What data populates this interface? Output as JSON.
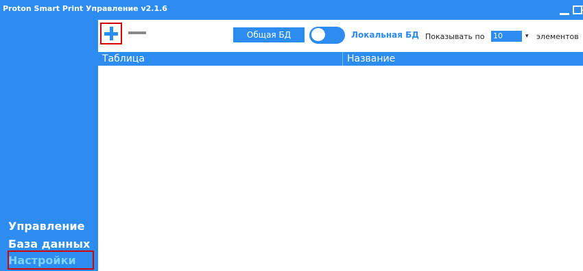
{
  "window": {
    "title": "Proton Smart Print Управление v2.1.6",
    "controls": {
      "minimize": "minimize-icon",
      "maximize": "maximize-icon",
      "close": "✕"
    }
  },
  "sidebar": {
    "items": [
      {
        "label": "Управление",
        "active": false
      },
      {
        "label": "База данных",
        "active": false
      },
      {
        "label": "Настройки",
        "active": true
      }
    ]
  },
  "toolbar": {
    "add_icon": "plus-icon",
    "remove_icon": "minus-icon",
    "shared_db_label": "Общая БД",
    "local_db_label": "Локальная БД",
    "db_toggle_state": "shared",
    "show_per_label": "Показывать по",
    "page_size": "10",
    "items_label": "элементов"
  },
  "table": {
    "columns": [
      "Таблица",
      "Название"
    ],
    "rows": []
  },
  "colors": {
    "accent": "#2d8cf0",
    "highlight": "#d40000",
    "active_nav": "#7fd3ff"
  }
}
